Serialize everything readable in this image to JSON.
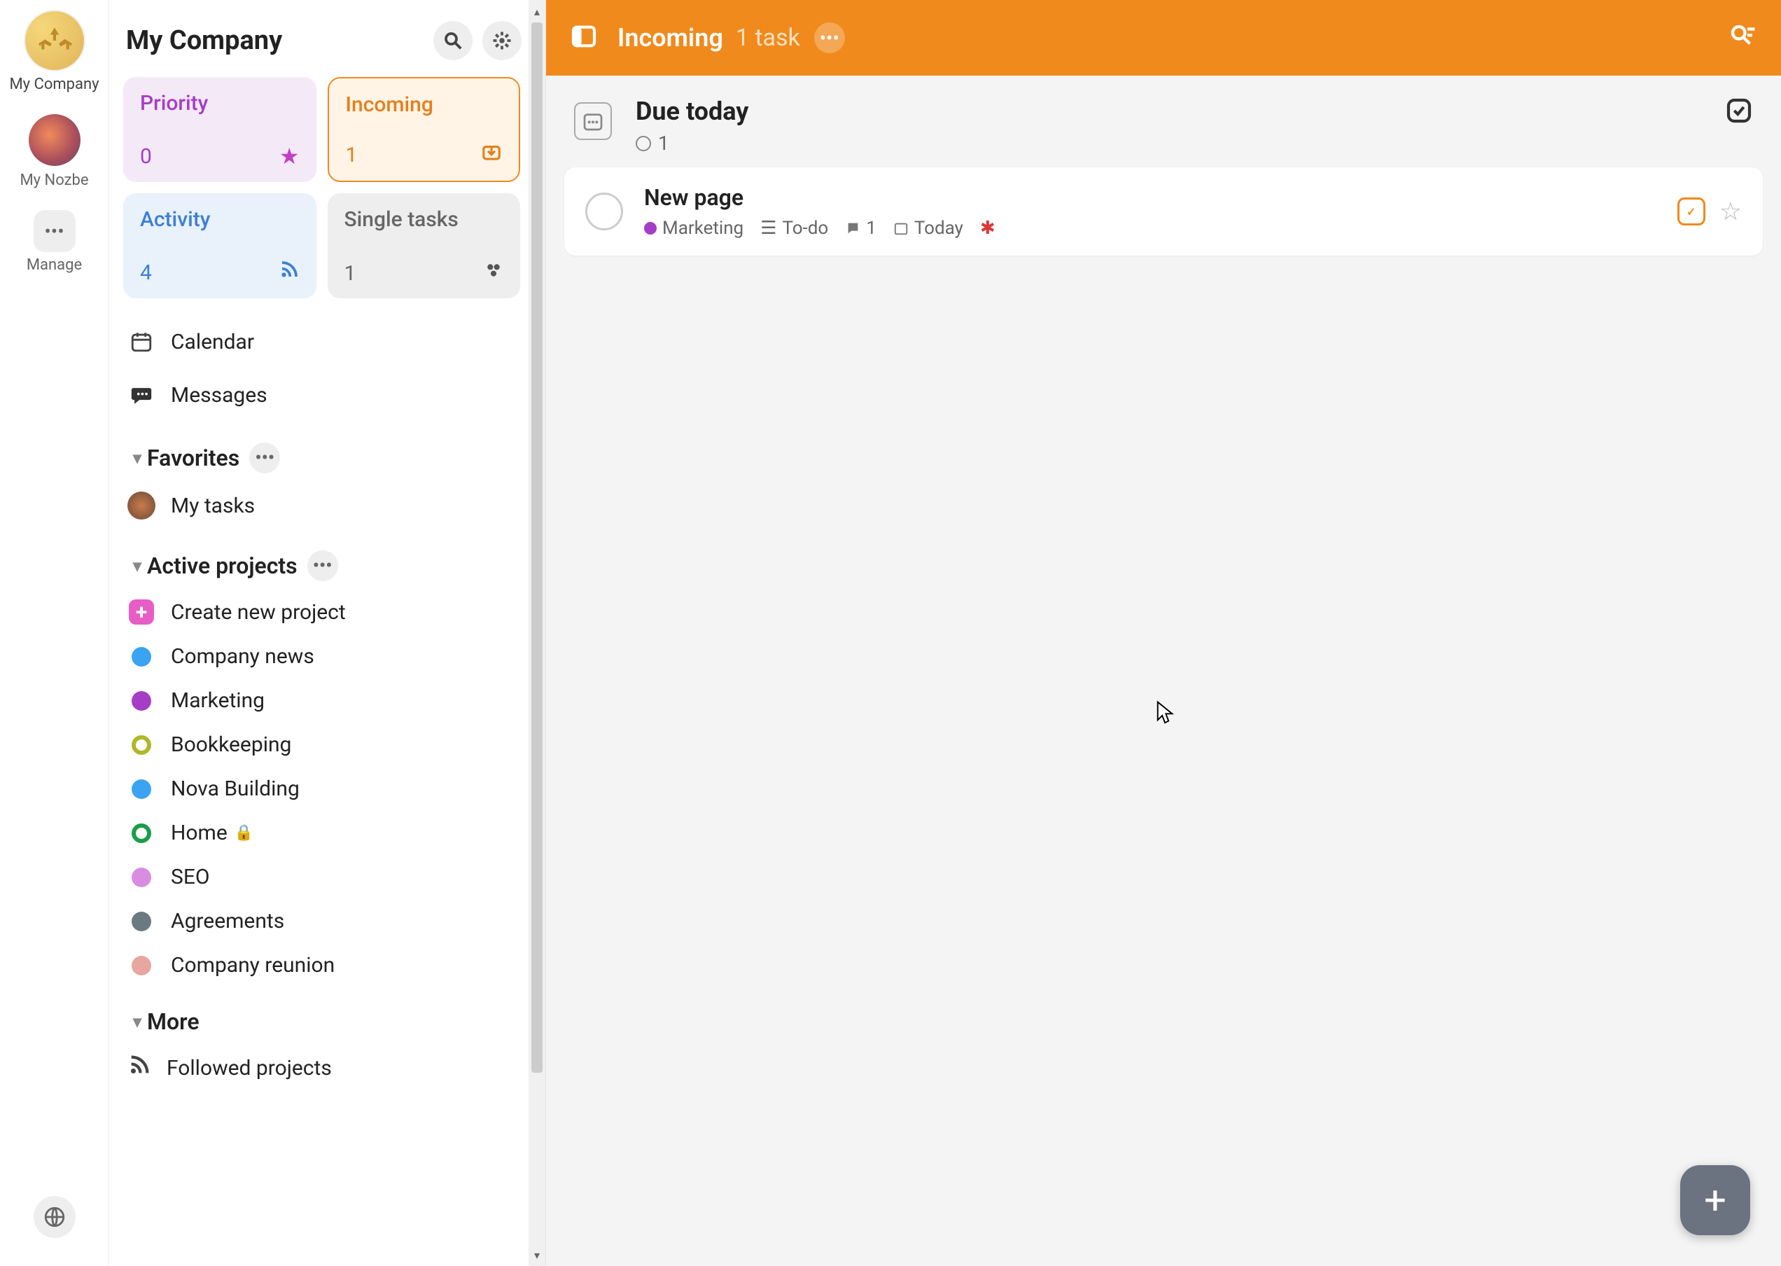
{
  "leftRail": {
    "workspace": "My Company",
    "personal": "My Nozbe",
    "manage": "Manage"
  },
  "sidebar": {
    "title": "My Company",
    "cards": {
      "priority": {
        "title": "Priority",
        "count": "0"
      },
      "incoming": {
        "title": "Incoming",
        "count": "1"
      },
      "activity": {
        "title": "Activity",
        "count": "4"
      },
      "singletasks": {
        "title": "Single tasks",
        "count": "1"
      }
    },
    "nav": {
      "calendar": "Calendar",
      "messages": "Messages"
    },
    "favorites": {
      "header": "Favorites",
      "items": {
        "mytasks": "My tasks"
      }
    },
    "activeProjects": {
      "header": "Active projects",
      "create": "Create new project",
      "items": [
        {
          "label": "Company news",
          "color": "#3aa3f2"
        },
        {
          "label": "Marketing",
          "color": "#a63dc6"
        },
        {
          "label": "Bookkeeping",
          "color": "#b0b82a",
          "ring": true
        },
        {
          "label": "Nova Building",
          "color": "#3aa3f2"
        },
        {
          "label": "Home",
          "color": "#1a9e4a",
          "ring": true,
          "locked": true
        },
        {
          "label": "SEO",
          "color": "#d98de0"
        },
        {
          "label": "Agreements",
          "color": "#6b7a80"
        },
        {
          "label": "Company reunion",
          "color": "#e8a6a0"
        }
      ]
    },
    "more": {
      "header": "More",
      "followed": "Followed projects"
    }
  },
  "topbar": {
    "title": "Incoming",
    "subtitle": "1 task"
  },
  "dueSection": {
    "title": "Due today",
    "count": "1"
  },
  "task": {
    "title": "New page",
    "project": "Marketing",
    "section": "To-do",
    "comments": "1",
    "due": "Today"
  }
}
